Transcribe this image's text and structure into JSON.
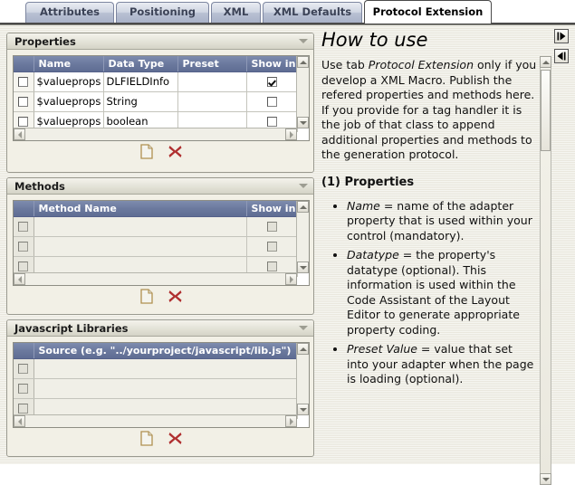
{
  "tabs": [
    {
      "label": "Attributes",
      "active": false
    },
    {
      "label": "Positioning",
      "active": false
    },
    {
      "label": "XML",
      "active": false
    },
    {
      "label": "XML Defaults",
      "active": false
    },
    {
      "label": "Protocol Extension",
      "active": true
    }
  ],
  "panels": {
    "properties": {
      "title": "Properties",
      "columns": [
        "",
        "Name",
        "Data Type",
        "Preset",
        "Show in"
      ],
      "rows": [
        {
          "selected": false,
          "name": "$valueprops",
          "datatype": "DLFIELDInfo",
          "preset": "",
          "show_in": true
        },
        {
          "selected": false,
          "name": "$valueprops",
          "datatype": "String",
          "preset": "",
          "show_in": false
        },
        {
          "selected": false,
          "name": "$valueprops",
          "datatype": "boolean",
          "preset": "",
          "show_in": false
        }
      ],
      "new_label": "new",
      "delete_label": "delete"
    },
    "methods": {
      "title": "Methods",
      "columns": [
        "",
        "Method Name",
        "Show in"
      ],
      "rows": [
        {
          "selected": false,
          "method_name": "",
          "show_in": false
        },
        {
          "selected": false,
          "method_name": "",
          "show_in": false
        },
        {
          "selected": false,
          "method_name": "",
          "show_in": false
        }
      ],
      "new_label": "new",
      "delete_label": "delete"
    },
    "javascript_libraries": {
      "title": "Javascript Libraries",
      "columns": [
        "",
        "Source (e.g. \"../yourproject/javascript/lib.js\")"
      ],
      "rows": [
        {
          "selected": false,
          "source": ""
        },
        {
          "selected": false,
          "source": ""
        },
        {
          "selected": false,
          "source": ""
        }
      ],
      "new_label": "new",
      "delete_label": "delete"
    }
  },
  "help": {
    "heading": "How to use",
    "intro_1": "Use tab ",
    "intro_em": "Protocol Extension",
    "intro_2": " only if you develop a XML Macro. Publish the refered properties and methods here. If you provide for a tag handler it is the job of that class to append additional properties and methods to the generation protocol.",
    "section_title": "(1) Properties",
    "bullets": [
      {
        "term": "Name",
        "text": " = name of the adapter property that is used within your control (mandatory)."
      },
      {
        "term": "Datatype",
        "text": " = the property's datatype  (optional). This information is used within the Code Assistant of the Layout Editor to generate appropriate property coding."
      },
      {
        "term": "Preset Value",
        "text": " = value that set into your adapter when the page is loading (optional)."
      }
    ]
  },
  "nav": {
    "forward_glyph": "▏▶",
    "back_glyph": "◀▕"
  },
  "colors": {
    "tab_active_bg": "#ffffff",
    "tab_inactive_bg": "#cfd5e2",
    "table_header_bg": "#6b799e",
    "panel_bg": "#f2f0e6",
    "frame_bg": "#eceae0",
    "delete_icon": "#b03030",
    "new_icon_border": "#b09050"
  }
}
